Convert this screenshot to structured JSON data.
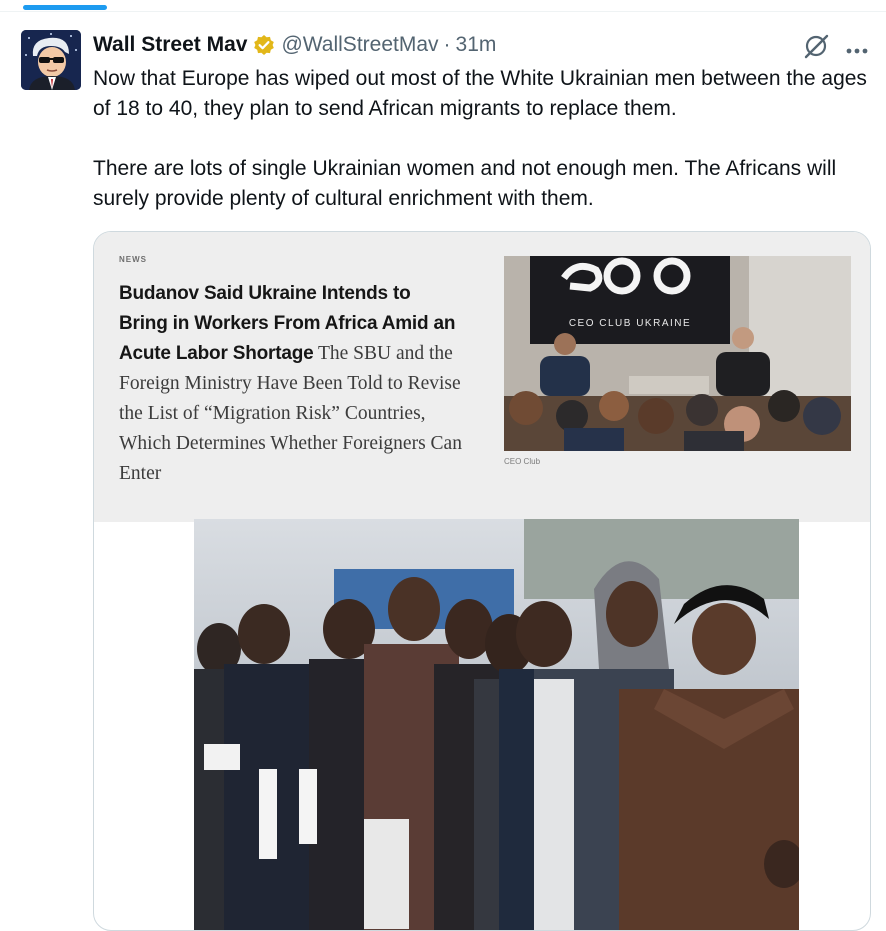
{
  "tweet": {
    "author_name": "Wall Street Mav",
    "handle": "@WallStreetMav",
    "separator": "·",
    "time": "31m",
    "paragraphs": [
      "Now that Europe has wiped out most of the White Ukrainian men between the ages of 18 to 40, they plan to send African migrants to replace them.",
      "There are lots of single Ukrainian women and not enough men. The Africans will surely provide plenty of cultural enrichment with them."
    ]
  },
  "article": {
    "section": "NEWS",
    "headline": "Budanov Said Ukraine Intends to Bring in Workers From Africa Amid an Acute Labor Shortage",
    "subhead": "The SBU and the Foreign Ministry Have Been Told to Revise the List of “Migration Risk” Countries, Which Determines Whether Foreigners Can Enter",
    "photo_credit": "CEO Club",
    "banner_text": "CEO CLUB UKRAINE"
  },
  "icons": {
    "verified": "verified-badge-icon",
    "grok": "grok-icon",
    "more": "more-options-icon"
  },
  "colors": {
    "accent": "#1d9bf0",
    "verified_gold": "#e2b719",
    "text_primary": "#0f1419",
    "text_secondary": "#536471"
  }
}
